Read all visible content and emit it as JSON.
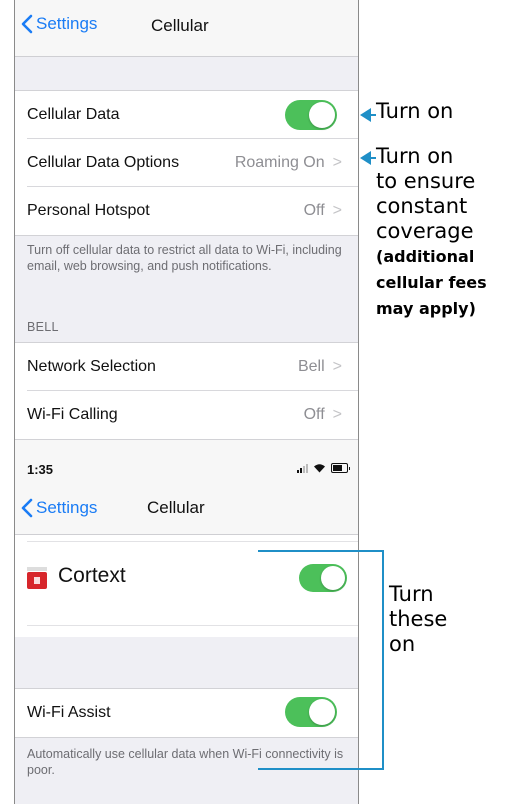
{
  "screen1": {
    "nav": {
      "back_label": "Settings",
      "title": "Cellular"
    },
    "rows": [
      {
        "label": "Cellular Data",
        "toggle": "on"
      },
      {
        "label": "Cellular Data Options",
        "value": "Roaming On"
      },
      {
        "label": "Personal Hotspot",
        "value": "Off"
      }
    ],
    "footnote": "Turn off cellular data to restrict all data to Wi-Fi, including email, web browsing, and push notifications.",
    "section_header": "BELL",
    "rows2": [
      {
        "label": "Network Selection",
        "value": "Bell"
      },
      {
        "label": "Wi-Fi Calling",
        "value": "Off"
      }
    ]
  },
  "screen2": {
    "status": {
      "time": "1:35"
    },
    "nav": {
      "back_label": "Settings",
      "title": "Cellular"
    },
    "app_row": {
      "label": "Cortext",
      "toggle": "on"
    },
    "wifi_assist": {
      "label": "Wi-Fi Assist",
      "toggle": "on"
    },
    "footnote": "Automatically use cellular data when Wi-Fi connectivity is poor."
  },
  "annotations": {
    "a1": "Turn on",
    "a2_line1": "Turn on",
    "a2_line2": "to ensure",
    "a2_line3": "constant",
    "a2_line4": "coverage",
    "a2_bold1": "(additional",
    "a2_bold2": "cellular fees",
    "a2_bold3": "may apply)",
    "a3_line1": "Turn",
    "a3_line2": "these",
    "a3_line3": "on"
  },
  "colors": {
    "ios_blue": "#1a7cf5",
    "toggle_green": "#4cc05a",
    "annotation_blue": "#1f8fc7"
  }
}
